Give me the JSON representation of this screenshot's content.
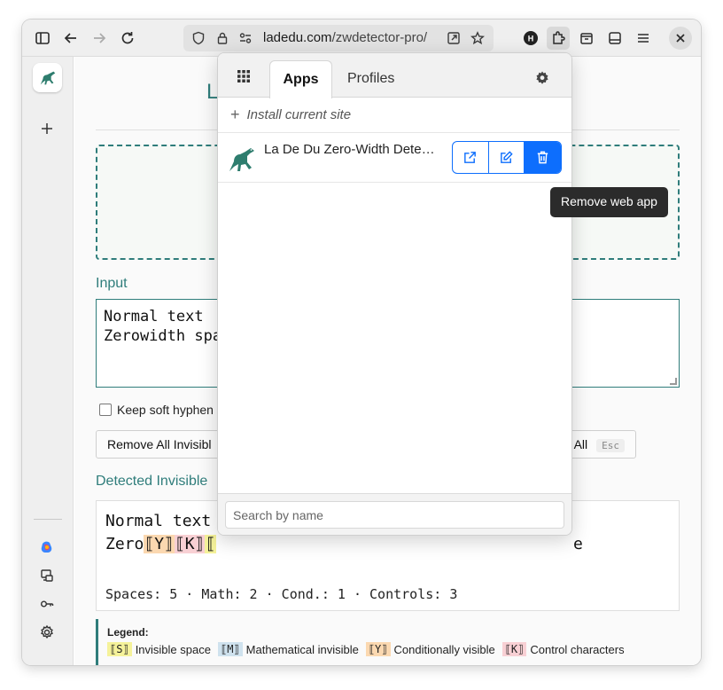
{
  "toolbar": {
    "url_domain": "ladedu.com",
    "url_path": "/zwdetector-pro/"
  },
  "page": {
    "title_partial": "L",
    "input_label": "Input",
    "input_value": "Normal text \nZerowidth spa",
    "keep_soft_hyphens_label": "Keep soft hyphen",
    "remove_button_label": "Remove All Invisibl",
    "clear_button_partial": "All",
    "clear_button_shortcut": "Esc",
    "detected_label": "Detected Invisible",
    "output_line1": "Normal text",
    "output_line2_prefix": "Zero",
    "output_markers": [
      "⟦Y⟧",
      "⟦K⟧",
      "⟦"
    ],
    "output_line2_tail": "e",
    "stats": "Spaces: 5 · Math: 2 · Cond.: 1 · Controls: 3"
  },
  "legend": {
    "title": "Legend:",
    "items": [
      {
        "marker": "⟦S⟧",
        "label": "Invisible space",
        "color": "#f5f29a"
      },
      {
        "marker": "⟦M⟧",
        "label": "Mathematical invisible",
        "color": "#cfe2ee"
      },
      {
        "marker": "⟦Y⟧",
        "label": "Conditionally visible",
        "color": "#fbd8b0"
      },
      {
        "marker": "⟦K⟧",
        "label": "Control characters",
        "color": "#f8d0d4"
      }
    ]
  },
  "popup": {
    "tabs": [
      "Apps",
      "Profiles"
    ],
    "install_label": "Install current site",
    "app_name": "La De Du Zero-Width Detector",
    "search_placeholder": "Search by name"
  },
  "tooltip": "Remove web app",
  "colors": {
    "accent": "#2f7d7b",
    "primary": "#0d6efd"
  }
}
